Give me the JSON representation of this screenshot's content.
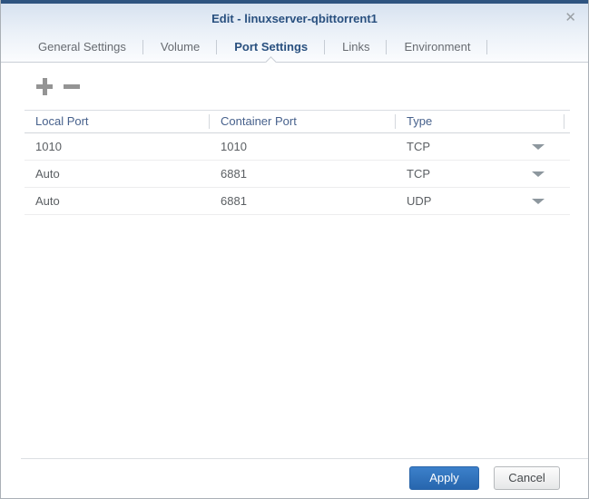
{
  "dialog": {
    "title": "Edit - linuxserver-qbittorrent1",
    "close_icon": "✕"
  },
  "tabs": [
    {
      "label": "General Settings",
      "active": false
    },
    {
      "label": "Volume",
      "active": false
    },
    {
      "label": "Port Settings",
      "active": true
    },
    {
      "label": "Links",
      "active": false
    },
    {
      "label": "Environment",
      "active": false
    }
  ],
  "toolbar": {
    "add_icon": "plus",
    "remove_icon": "minus"
  },
  "port_table": {
    "columns": [
      "Local Port",
      "Container Port",
      "Type"
    ],
    "rows": [
      {
        "local_port": "1010",
        "container_port": "1010",
        "type": "TCP"
      },
      {
        "local_port": "Auto",
        "container_port": "6881",
        "type": "TCP"
      },
      {
        "local_port": "Auto",
        "container_port": "6881",
        "type": "UDP"
      }
    ]
  },
  "footer": {
    "apply_label": "Apply",
    "cancel_label": "Cancel"
  },
  "colors": {
    "title_bar_accent": "#2e5480",
    "title_text": "#29507f",
    "active_tab_text": "#29507f",
    "apply_button": "#2f6db9"
  }
}
